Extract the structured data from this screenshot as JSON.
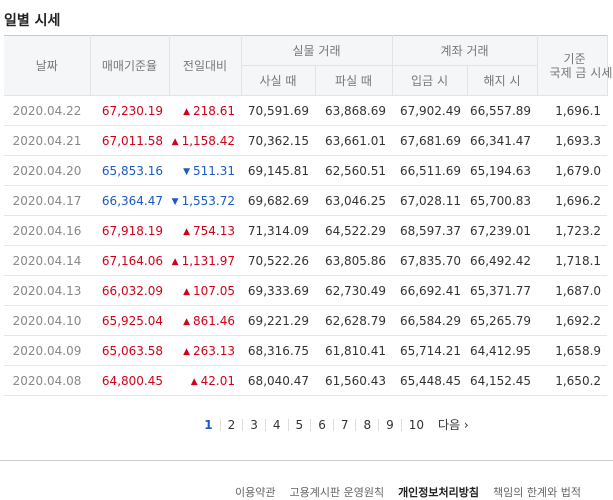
{
  "title": "일별 시세",
  "headers": {
    "date": "날짜",
    "base_rate": "매매기준율",
    "change": "전일대비",
    "cash": "실물 거래",
    "cash_buy": "사실 때",
    "cash_sell": "파실 때",
    "account": "계좌 거래",
    "deposit": "입금 시",
    "withdraw": "해지 시",
    "intl_line1": "기준",
    "intl_line2": "국제 금 시세"
  },
  "rows": [
    {
      "date": "2020.04.22",
      "base": "67,230.19",
      "dir": "up",
      "change": "218.61",
      "buy": "70,591.69",
      "sell": "63,868.69",
      "deposit": "67,902.49",
      "withdraw": "66,557.89",
      "intl": "1,696.1"
    },
    {
      "date": "2020.04.21",
      "base": "67,011.58",
      "dir": "up",
      "change": "1,158.42",
      "buy": "70,362.15",
      "sell": "63,661.01",
      "deposit": "67,681.69",
      "withdraw": "66,341.47",
      "intl": "1,693.3"
    },
    {
      "date": "2020.04.20",
      "base": "65,853.16",
      "dir": "down",
      "change": "511.31",
      "buy": "69,145.81",
      "sell": "62,560.51",
      "deposit": "66,511.69",
      "withdraw": "65,194.63",
      "intl": "1,679.0"
    },
    {
      "date": "2020.04.17",
      "base": "66,364.47",
      "dir": "down",
      "change": "1,553.72",
      "buy": "69,682.69",
      "sell": "63,046.25",
      "deposit": "67,028.11",
      "withdraw": "65,700.83",
      "intl": "1,696.2"
    },
    {
      "date": "2020.04.16",
      "base": "67,918.19",
      "dir": "up",
      "change": "754.13",
      "buy": "71,314.09",
      "sell": "64,522.29",
      "deposit": "68,597.37",
      "withdraw": "67,239.01",
      "intl": "1,723.2"
    },
    {
      "date": "2020.04.14",
      "base": "67,164.06",
      "dir": "up",
      "change": "1,131.97",
      "buy": "70,522.26",
      "sell": "63,805.86",
      "deposit": "67,835.70",
      "withdraw": "66,492.42",
      "intl": "1,718.1"
    },
    {
      "date": "2020.04.13",
      "base": "66,032.09",
      "dir": "up",
      "change": "107.05",
      "buy": "69,333.69",
      "sell": "62,730.49",
      "deposit": "66,692.41",
      "withdraw": "65,371.77",
      "intl": "1,687.0"
    },
    {
      "date": "2020.04.10",
      "base": "65,925.04",
      "dir": "up",
      "change": "861.46",
      "buy": "69,221.29",
      "sell": "62,628.79",
      "deposit": "66,584.29",
      "withdraw": "65,265.79",
      "intl": "1,692.2"
    },
    {
      "date": "2020.04.09",
      "base": "65,063.58",
      "dir": "up",
      "change": "263.13",
      "buy": "68,316.75",
      "sell": "61,810.41",
      "deposit": "65,714.21",
      "withdraw": "64,412.95",
      "intl": "1,658.9"
    },
    {
      "date": "2020.04.08",
      "base": "64,800.45",
      "dir": "up",
      "change": "42.01",
      "buy": "68,040.47",
      "sell": "61,560.43",
      "deposit": "65,448.45",
      "withdraw": "64,152.45",
      "intl": "1,650.2"
    }
  ],
  "arrows": {
    "up": "▲",
    "down": "▼"
  },
  "colors": {
    "up": "#d0021b",
    "down": "#1a5bc4"
  },
  "pagination": {
    "pages": [
      "1",
      "2",
      "3",
      "4",
      "5",
      "6",
      "7",
      "8",
      "9",
      "10"
    ],
    "active": "1",
    "next_label": "다음 ›"
  },
  "footer": {
    "links": [
      "이용약관",
      "고용계시판 운영원칙",
      "개인정보처리방침",
      "책임의 한계와 법적"
    ]
  }
}
